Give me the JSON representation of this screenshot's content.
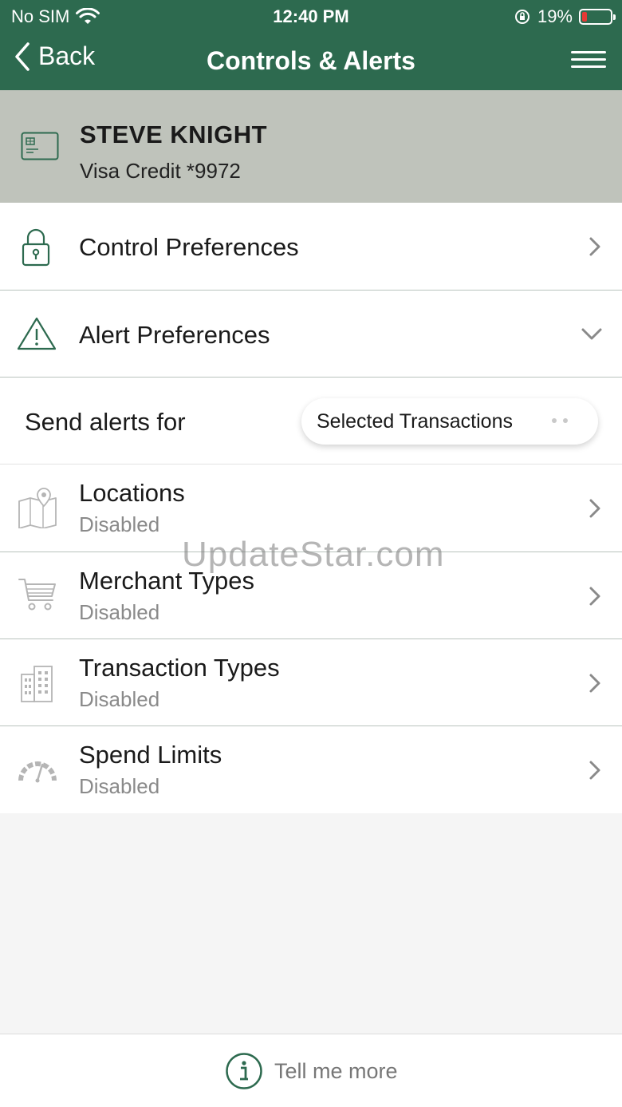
{
  "status_bar": {
    "carrier": "No SIM",
    "time": "12:40 PM",
    "battery": "19%",
    "battery_level": 0.19
  },
  "nav": {
    "back_label": "Back",
    "title": "Controls & Alerts"
  },
  "card": {
    "holder": "STEVE KNIGHT",
    "account": "Visa Credit *9972"
  },
  "sections": {
    "control": {
      "label": "Control Preferences"
    },
    "alert": {
      "label": "Alert Preferences"
    }
  },
  "send_alerts": {
    "label": "Send alerts for",
    "value": "Selected Transactions"
  },
  "alert_items": [
    {
      "label": "Locations",
      "status": "Disabled",
      "icon": "map-pin-icon"
    },
    {
      "label": "Merchant Types",
      "status": "Disabled",
      "icon": "shopping-cart-icon"
    },
    {
      "label": "Transaction Types",
      "status": "Disabled",
      "icon": "buildings-icon"
    },
    {
      "label": "Spend Limits",
      "status": "Disabled",
      "icon": "speedometer-icon"
    }
  ],
  "watermark": "UpdateStar.com",
  "footer": {
    "tell_more": "Tell me more"
  },
  "colors": {
    "primary": "#2d6a4f",
    "card_bg": "#bfc3bb",
    "muted": "#8a8a8a"
  }
}
